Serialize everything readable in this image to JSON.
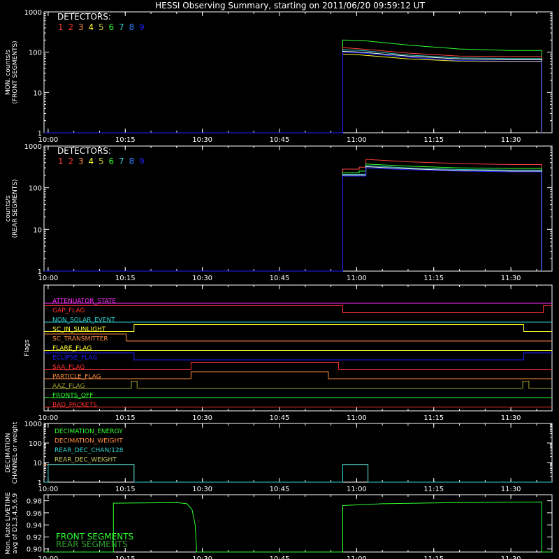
{
  "title": "HESSI Observing Summary, starting on 2011/06/20 09:59:12 UT",
  "time_ticks": [
    "10:00",
    "10:15",
    "10:30",
    "10:45",
    "11:00",
    "11:15",
    "11:30"
  ],
  "detector_digits": [
    "1",
    "2",
    "3",
    "4",
    "5",
    "6",
    "7",
    "8",
    "9"
  ],
  "detector_colors": [
    "#ff4040",
    "#ff3030",
    "#ff8c40",
    "#ffff30",
    "#c8c840",
    "#30ff30",
    "#30c8c8",
    "#3080ff",
    "#2020ff"
  ],
  "chart_data": [
    {
      "type": "line",
      "ylabel": [
        "MON. counts/s",
        "(FRONT SEGMENTS)"
      ],
      "yscale": "log",
      "ylim": [
        1,
        1000
      ],
      "yticks": [
        "1",
        "10",
        "100",
        "1000"
      ],
      "xlim_minutes": [
        -0.8,
        98
      ],
      "legend_title": "DETECTORS:",
      "series": [
        {
          "color": "#30ff30",
          "points": [
            [
              -0.8,
              1
            ],
            [
              57.3,
              1
            ],
            [
              57.3,
              200
            ],
            [
              61,
              195
            ],
            [
              70,
              150
            ],
            [
              80,
              120
            ],
            [
              90,
              110
            ],
            [
              96,
              110
            ],
            [
              96,
              1
            ]
          ]
        },
        {
          "color": "#ff4040",
          "points": [
            [
              -0.8,
              1
            ],
            [
              57.3,
              1
            ],
            [
              57.3,
              130
            ],
            [
              61,
              120
            ],
            [
              70,
              95
            ],
            [
              80,
              80
            ],
            [
              90,
              78
            ],
            [
              96,
              78
            ],
            [
              96,
              1
            ]
          ]
        },
        {
          "color": "#30c8c8",
          "points": [
            [
              -0.8,
              1
            ],
            [
              57.3,
              1
            ],
            [
              57.3,
              115
            ],
            [
              61,
              110
            ],
            [
              70,
              85
            ],
            [
              80,
              72
            ],
            [
              90,
              70
            ],
            [
              96,
              70
            ],
            [
              96,
              1
            ]
          ]
        },
        {
          "color": "#ffffff",
          "points": [
            [
              -0.8,
              1
            ],
            [
              57.3,
              1
            ],
            [
              57.3,
              105
            ],
            [
              61,
              100
            ],
            [
              70,
              80
            ],
            [
              80,
              68
            ],
            [
              90,
              65
            ],
            [
              96,
              65
            ],
            [
              96,
              1
            ]
          ]
        },
        {
          "color": "#ffff30",
          "points": [
            [
              -0.8,
              1
            ],
            [
              57.3,
              1
            ],
            [
              57.3,
              90
            ],
            [
              61,
              85
            ],
            [
              70,
              68
            ],
            [
              80,
              60
            ],
            [
              90,
              58
            ],
            [
              96,
              58
            ],
            [
              96,
              1
            ]
          ]
        },
        {
          "color": "#2020ff",
          "points": [
            [
              -0.8,
              1
            ],
            [
              57.3,
              1
            ],
            [
              57.3,
              100
            ],
            [
              61,
              95
            ],
            [
              70,
              75
            ],
            [
              80,
              62
            ],
            [
              90,
              60
            ],
            [
              96,
              60
            ],
            [
              96,
              1
            ]
          ]
        }
      ]
    },
    {
      "type": "line",
      "ylabel": [
        "counts/s",
        "(REAR SEGMENTS)"
      ],
      "yscale": "log",
      "ylim": [
        1,
        1000
      ],
      "yticks": [
        "1",
        "10",
        "100",
        "1000"
      ],
      "xlim_minutes": [
        -0.8,
        98
      ],
      "legend_title": "DETECTORS:",
      "series": [
        {
          "color": "#ff4040",
          "points": [
            [
              -0.8,
              1
            ],
            [
              57.3,
              1
            ],
            [
              57.3,
              280
            ],
            [
              60.5,
              280
            ],
            [
              60.5,
              310
            ],
            [
              61.8,
              310
            ],
            [
              61.8,
              480
            ],
            [
              70,
              420
            ],
            [
              80,
              380
            ],
            [
              90,
              360
            ],
            [
              96,
              360
            ],
            [
              96,
              1
            ]
          ]
        },
        {
          "color": "#30ff30",
          "points": [
            [
              -0.8,
              1
            ],
            [
              57.3,
              1
            ],
            [
              57.3,
              230
            ],
            [
              60.5,
              230
            ],
            [
              60.5,
              250
            ],
            [
              61.8,
              250
            ],
            [
              61.8,
              370
            ],
            [
              70,
              330
            ],
            [
              80,
              300
            ],
            [
              90,
              290
            ],
            [
              96,
              290
            ],
            [
              96,
              1
            ]
          ]
        },
        {
          "color": "#30c8c8",
          "points": [
            [
              -0.8,
              1
            ],
            [
              57.3,
              1
            ],
            [
              57.3,
              210
            ],
            [
              61.8,
              210
            ],
            [
              61.8,
              340
            ],
            [
              70,
              300
            ],
            [
              80,
              275
            ],
            [
              90,
              265
            ],
            [
              96,
              265
            ],
            [
              96,
              1
            ]
          ]
        },
        {
          "color": "#ffffff",
          "points": [
            [
              -0.8,
              1
            ],
            [
              57.3,
              1
            ],
            [
              57.3,
              200
            ],
            [
              61.8,
              200
            ],
            [
              61.8,
              320
            ],
            [
              70,
              285
            ],
            [
              80,
              260
            ],
            [
              90,
              250
            ],
            [
              96,
              250
            ],
            [
              96,
              1
            ]
          ]
        },
        {
          "color": "#2020ff",
          "points": [
            [
              -0.8,
              1
            ],
            [
              57.3,
              1
            ],
            [
              57.3,
              190
            ],
            [
              61.8,
              190
            ],
            [
              61.8,
              300
            ],
            [
              70,
              270
            ],
            [
              80,
              250
            ],
            [
              90,
              240
            ],
            [
              96,
              240
            ],
            [
              96,
              1
            ]
          ]
        }
      ]
    },
    {
      "type": "line",
      "ylabel": [
        "Flags"
      ],
      "xlim_minutes": [
        -0.8,
        98
      ],
      "flags": [
        {
          "label": "ATTENUATOR_STATE",
          "color": "#ff30ff",
          "segments": [
            [
              -0.8,
              0
            ],
            [
              98,
              0
            ]
          ]
        },
        {
          "label": "GAP_FLAG",
          "color": "#ff3030",
          "segments": [
            [
              -0.8,
              1
            ],
            [
              57.3,
              1
            ],
            [
              57.3,
              0
            ],
            [
              96.3,
              0
            ],
            [
              96.3,
              1
            ],
            [
              98,
              1
            ]
          ]
        },
        {
          "label": "NON_SOLAR_EVENT",
          "color": "#30d0d0",
          "segments": [
            [
              -0.8,
              0
            ],
            [
              98,
              0
            ]
          ]
        },
        {
          "label": "SC_IN_SUNLIGHT",
          "color": "#ffff30",
          "segments": [
            [
              -0.8,
              0
            ],
            [
              16.7,
              0
            ],
            [
              16.7,
              1
            ],
            [
              92.5,
              1
            ],
            [
              92.5,
              0
            ],
            [
              98,
              0
            ]
          ]
        },
        {
          "label": "SC_TRANSMITTER",
          "color": "#ff8c40",
          "segments": [
            [
              -0.8,
              1
            ],
            [
              15.2,
              1
            ],
            [
              15.2,
              0
            ],
            [
              98,
              0
            ]
          ]
        },
        {
          "label": "FLARE_FLAG",
          "color": "#ffff30",
          "segments": [
            [
              -0.8,
              0
            ],
            [
              98,
              0
            ]
          ]
        },
        {
          "label": "ECLIPSE_FLAG",
          "color": "#2020ff",
          "segments": [
            [
              -0.8,
              1
            ],
            [
              16.7,
              1
            ],
            [
              16.7,
              0
            ],
            [
              92.5,
              0
            ],
            [
              92.5,
              1
            ],
            [
              98,
              1
            ]
          ]
        },
        {
          "label": "SAA_FLAG",
          "color": "#ff3030",
          "segments": [
            [
              -0.8,
              0
            ],
            [
              27.8,
              0
            ],
            [
              27.8,
              1
            ],
            [
              56.5,
              1
            ],
            [
              56.5,
              0
            ],
            [
              98,
              0
            ]
          ]
        },
        {
          "label": "PARTICLE_FLAG",
          "color": "#ff8c40",
          "segments": [
            [
              -0.8,
              0
            ],
            [
              27.8,
              0
            ],
            [
              27.8,
              1
            ],
            [
              54.5,
              1
            ],
            [
              54.5,
              0
            ],
            [
              98,
              0
            ]
          ]
        },
        {
          "label": "AAZ_FLAG",
          "color": "#a0a030",
          "segments": [
            [
              -0.8,
              0
            ],
            [
              16.2,
              0
            ],
            [
              16.2,
              1
            ],
            [
              17.3,
              1
            ],
            [
              17.3,
              0
            ],
            [
              92.3,
              0
            ],
            [
              92.3,
              1
            ],
            [
              93.5,
              1
            ],
            [
              93.5,
              0
            ],
            [
              98,
              0
            ]
          ]
        },
        {
          "label": "FRONTS_OFF",
          "color": "#30ff30",
          "segments": [
            [
              -0.8,
              0
            ],
            [
              98,
              0
            ]
          ]
        },
        {
          "label": "BAD_PACKETS",
          "color": "#ff3030",
          "segments": [
            [
              -0.8,
              0
            ],
            [
              98,
              0
            ]
          ]
        }
      ]
    },
    {
      "type": "line",
      "ylabel": [
        "DECIMATION",
        "CHANNEL or weight"
      ],
      "yscale": "log",
      "ylim": [
        1,
        1000
      ],
      "yticks": [
        "1",
        "10",
        "100",
        "1000"
      ],
      "xlim_minutes": [
        -0.8,
        98
      ],
      "legend": [
        {
          "label": "DECIMATION_ENERGY",
          "color": "#30ff30"
        },
        {
          "label": "DECIMATION_WEIGHT",
          "color": "#ff8c40"
        },
        {
          "label": "REAR_DEC_CHAN/128",
          "color": "#30d0d0"
        },
        {
          "label": "REAR_DEC_WEIGHT",
          "color": "#c8c860"
        }
      ],
      "series": [
        {
          "color": "#ff8c40",
          "points": [
            [
              -0.8,
              8
            ],
            [
              16.7,
              8
            ],
            [
              16.7,
              1
            ],
            [
              57.3,
              1
            ],
            [
              57.3,
              8
            ],
            [
              62.2,
              8
            ],
            [
              62.2,
              1
            ],
            [
              98,
              1
            ]
          ]
        },
        {
          "color": "#30d0d0",
          "points": [
            [
              -0.8,
              1
            ],
            [
              0,
              1
            ],
            [
              0,
              8
            ],
            [
              16.7,
              8
            ],
            [
              16.7,
              1
            ],
            [
              57.3,
              1
            ],
            [
              57.3,
              8
            ],
            [
              62.2,
              8
            ],
            [
              62.2,
              1
            ],
            [
              98,
              1
            ]
          ]
        }
      ]
    },
    {
      "type": "line",
      "ylabel": [
        "Mon. Rate LIVETIME",
        "avg of D1,3,4,5,6,9"
      ],
      "ylim": [
        0.895,
        0.99
      ],
      "yticks": [
        "0.90",
        "0.92",
        "0.94",
        "0.96",
        "0.98"
      ],
      "xlim_minutes": [
        -0.8,
        98
      ],
      "legend": [
        {
          "label": "FRONT SEGMENTS",
          "color": "#30ff30"
        },
        {
          "label": "REAR SEGMENTS",
          "color": "#30a030"
        }
      ],
      "series": [
        {
          "color": "#30ff30",
          "points": [
            [
              -0.8,
              0.895
            ],
            [
              12.7,
              0.895
            ],
            [
              12.7,
              0.976
            ],
            [
              25,
              0.977
            ],
            [
              27,
              0.975
            ],
            [
              28,
              0.965
            ],
            [
              28.6,
              0.94
            ],
            [
              28.9,
              0.895
            ],
            [
              57.3,
              0.895
            ],
            [
              57.3,
              0.972
            ],
            [
              65,
              0.975
            ],
            [
              80,
              0.977
            ],
            [
              96,
              0.978
            ],
            [
              96,
              0.895
            ],
            [
              98,
              0.895
            ]
          ]
        }
      ]
    }
  ]
}
